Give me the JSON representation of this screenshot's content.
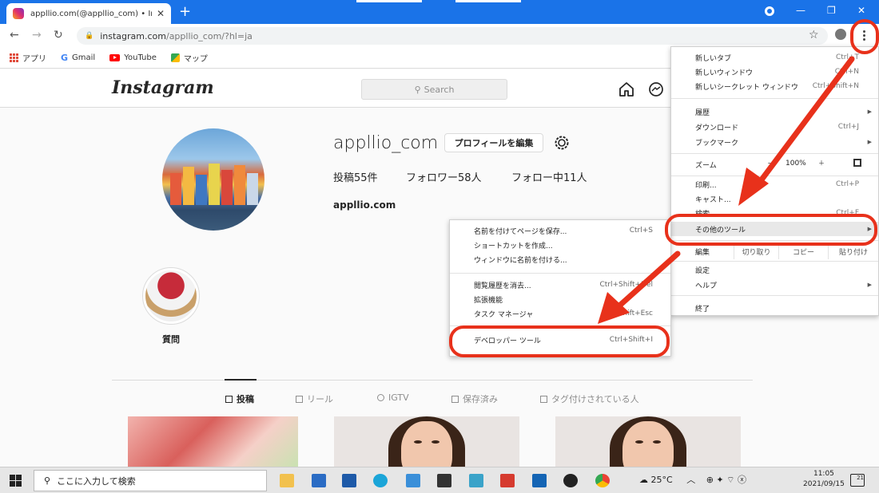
{
  "browser": {
    "tab_title": "appllio.com(@appllio_com) • Ins",
    "url_host": "instagram.com",
    "url_path": "/appllio_com/?hl=ja",
    "bookmarks": [
      "アプリ",
      "Gmail",
      "YouTube",
      "マップ"
    ]
  },
  "instagram": {
    "logo": "Instagram",
    "search_placeholder": "Search",
    "username": "appllio_com",
    "edit_profile": "プロフィールを編集",
    "stats": [
      "投稿55件",
      "フォロワー58人",
      "フォロー中11人"
    ],
    "website": "appllio.com",
    "highlight_label": "質問",
    "tabs": [
      "投稿",
      "リール",
      "IGTV",
      "保存済み",
      "タグ付けされている人"
    ]
  },
  "chrome_menu": {
    "items_top": [
      {
        "label": "新しいタブ",
        "shortcut": "Ctrl+T"
      },
      {
        "label": "新しいウィンドウ",
        "shortcut": "Ctrl+N"
      },
      {
        "label": "新しいシークレット ウィンドウ",
        "shortcut": "Ctrl+Shift+N"
      }
    ],
    "items_history": [
      {
        "label": "履歴",
        "shortcut": ""
      },
      {
        "label": "ダウンロード",
        "shortcut": "Ctrl+J"
      },
      {
        "label": "ブックマーク",
        "shortcut": ""
      }
    ],
    "zoom_label": "ズーム",
    "zoom_value": "100%",
    "items_print": [
      {
        "label": "印刷...",
        "shortcut": "Ctrl+P"
      },
      {
        "label": "キャスト...",
        "shortcut": ""
      },
      {
        "label": "検索...",
        "shortcut": "Ctrl+F"
      }
    ],
    "more_tools": "その他のツール",
    "edit_label": "編集",
    "edit_buttons": [
      "切り取り",
      "コピー",
      "貼り付け"
    ],
    "settings": "設定",
    "help": "ヘルプ",
    "exit": "終了"
  },
  "submenu": {
    "group1": [
      {
        "label": "名前を付けてページを保存...",
        "shortcut": "Ctrl+S"
      },
      {
        "label": "ショートカットを作成...",
        "shortcut": ""
      },
      {
        "label": "ウィンドウに名前を付ける...",
        "shortcut": ""
      }
    ],
    "group2": [
      {
        "label": "閲覧履歴を消去...",
        "shortcut": "Ctrl+Shift+Del"
      },
      {
        "label": "拡張機能",
        "shortcut": ""
      },
      {
        "label": "タスク マネージャ",
        "shortcut": "Shift+Esc"
      }
    ],
    "devtools": {
      "label": "デベロッパー ツール",
      "shortcut": "Ctrl+Shift+I"
    }
  },
  "taskbar": {
    "search_placeholder": "ここに入力して検索",
    "weather": "25°C",
    "time": "11:05",
    "date": "2021/09/15",
    "notification_count": "21"
  },
  "colors": {
    "chrome_blue": "#1a73e8",
    "annotation_red": "#e8311b"
  }
}
